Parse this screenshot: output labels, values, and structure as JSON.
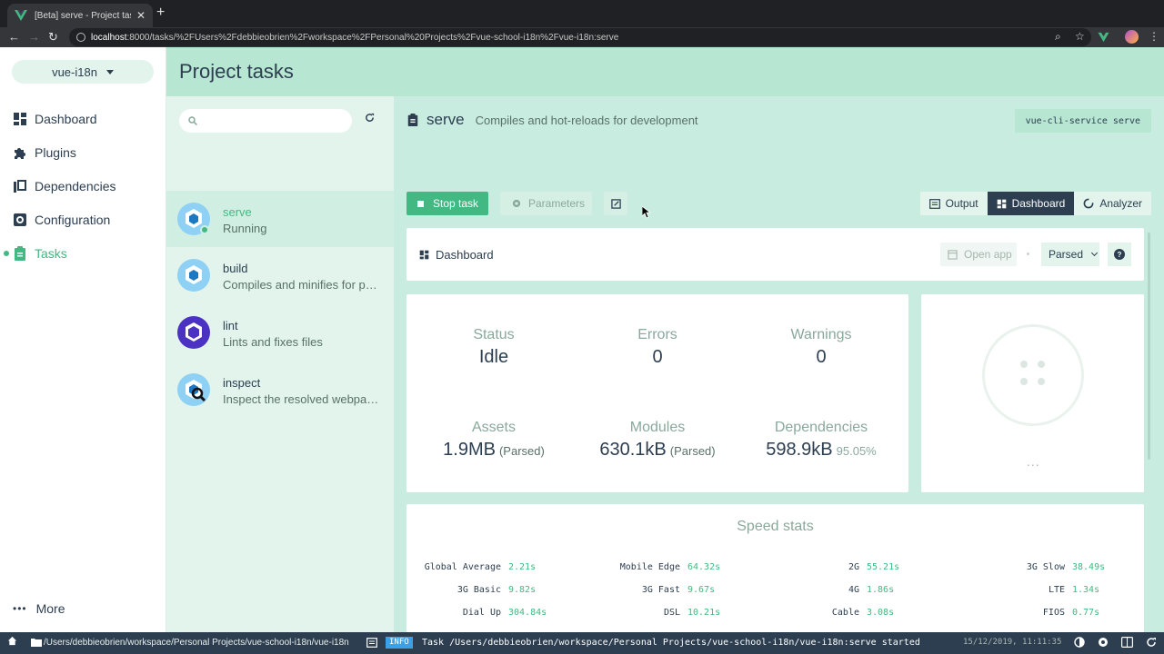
{
  "browser": {
    "tab_title": "[Beta] serve - Project tasks - Vue CLI",
    "url_host": "localhost",
    "url_rest": ":8000/tasks/%2FUsers%2Fdebbieobrien%2Fworkspace%2FPersonal%20Projects%2Fvue-school-i18n%2Fvue-i18n:serve"
  },
  "sidebar": {
    "project": "vue-i18n",
    "items": [
      {
        "label": "Dashboard",
        "icon": "dashboard-icon"
      },
      {
        "label": "Plugins",
        "icon": "puzzle-icon"
      },
      {
        "label": "Dependencies",
        "icon": "book-icon"
      },
      {
        "label": "Configuration",
        "icon": "gear-icon"
      },
      {
        "label": "Tasks",
        "icon": "clipboard-icon",
        "active": true
      }
    ],
    "more": "More"
  },
  "header": {
    "title": "Project tasks"
  },
  "tasks": [
    {
      "name": "serve",
      "desc": "Running"
    },
    {
      "name": "build",
      "desc": "Compiles and minifies for production"
    },
    {
      "name": "lint",
      "desc": "Lints and fixes files"
    },
    {
      "name": "inspect",
      "desc": "Inspect the resolved webpack config"
    }
  ],
  "detail": {
    "name": "serve",
    "desc": "Compiles and hot-reloads for development",
    "command": "vue-cli-service serve",
    "stop_label": "Stop task",
    "params_label": "Parameters",
    "views": [
      "Output",
      "Dashboard",
      "Analyzer"
    ],
    "active_view": "Dashboard"
  },
  "dashboard": {
    "title": "Dashboard",
    "open_app": "Open app",
    "mode": "Parsed",
    "stats": {
      "status": {
        "label": "Status",
        "value": "Idle"
      },
      "errors": {
        "label": "Errors",
        "value": "0"
      },
      "warnings": {
        "label": "Warnings",
        "value": "0"
      },
      "assets": {
        "label": "Assets",
        "value": "1.9MB",
        "note": "(Parsed)"
      },
      "modules": {
        "label": "Modules",
        "value": "630.1kB",
        "note": "(Parsed)"
      },
      "deps": {
        "label": "Dependencies",
        "value": "598.9kB",
        "note": "95.05%"
      }
    },
    "donut_more": "..."
  },
  "speed": {
    "title": "Speed stats",
    "rows": [
      [
        [
          "Global Average",
          "2.21s"
        ],
        [
          "Mobile Edge",
          "64.32s"
        ],
        [
          "2G",
          "55.21s"
        ],
        [
          "3G Slow",
          "38.49s"
        ]
      ],
      [
        [
          "3G Basic",
          "9.82s"
        ],
        [
          "3G Fast",
          "9.67s"
        ],
        [
          "4G",
          "1.86s"
        ],
        [
          "LTE",
          "1.34s"
        ]
      ],
      [
        [
          "Dial Up",
          "304.84s"
        ],
        [
          "DSL",
          "10.21s"
        ],
        [
          "Cable",
          "3.08s"
        ],
        [
          "FIOS",
          "0.77s"
        ]
      ]
    ]
  },
  "statusbar": {
    "path": "/Users/debbieobrien/workspace/Personal Projects/vue-school-i18n/vue-i18n",
    "level": "INFO",
    "message": "Task /Users/debbieobrien/workspace/Personal Projects/vue-school-i18n/vue-i18n:serve started",
    "time": "15/12/2019, 11:11:35"
  },
  "colors": {
    "accent": "#42b983",
    "dark": "#2c3e50",
    "header": "#b7e6d2",
    "tasklist": "#e2f4ec",
    "content": "#c9ece0"
  }
}
